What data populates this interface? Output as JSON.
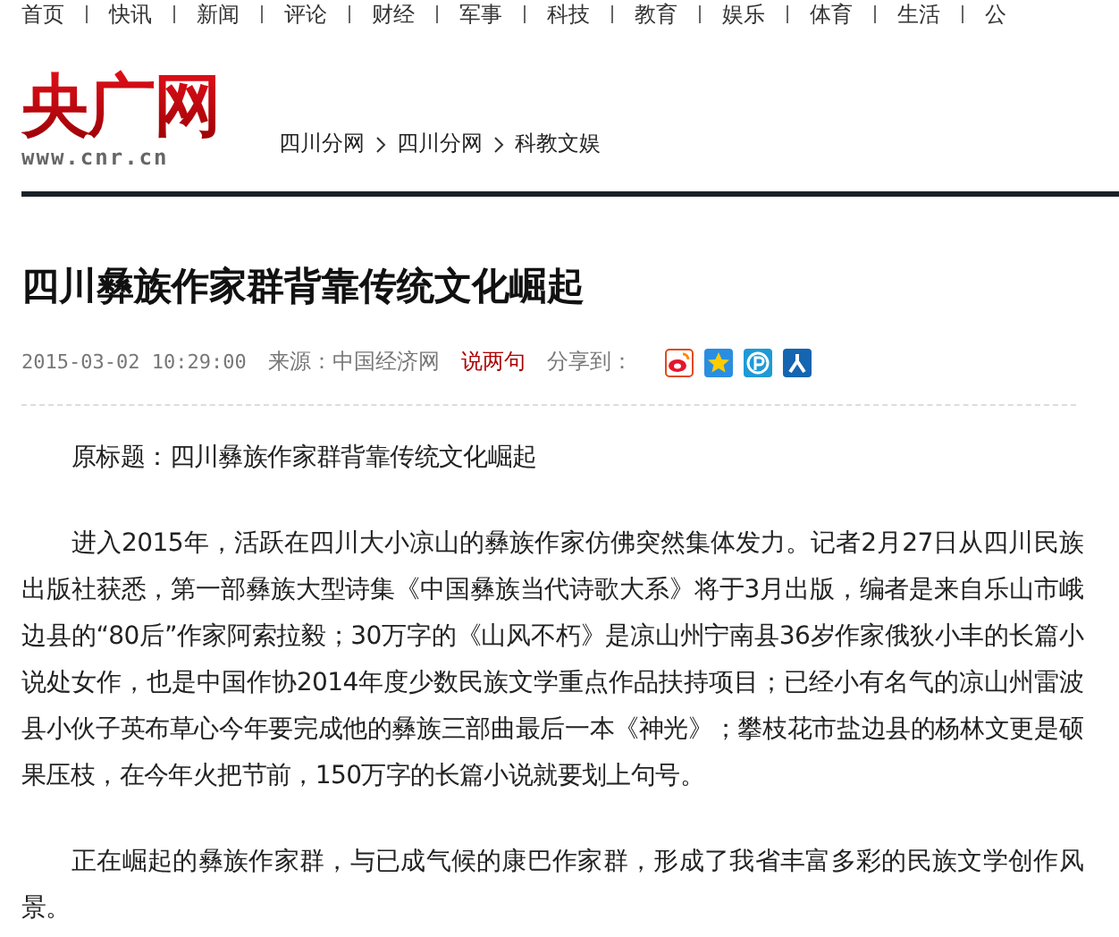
{
  "top_nav": [
    "首页",
    "快讯",
    "新闻",
    "评论",
    "财经",
    "军事",
    "科技",
    "教育",
    "娱乐",
    "体育",
    "生活",
    "公"
  ],
  "logo": {
    "name": "央广网",
    "url": "www.cnr.cn"
  },
  "breadcrumb": [
    "四川分网",
    "四川分网",
    "科教文娱"
  ],
  "article": {
    "title": "四川彝族作家群背靠传统文化崛起",
    "meta": {
      "date": "2015-03-02 10:29:00",
      "source": "来源：中国经济网",
      "comment_link": "说两句",
      "share_label": "分享到："
    },
    "share_icons": [
      {
        "kind": "weibo"
      },
      {
        "kind": "qzone"
      },
      {
        "kind": "pengyou"
      },
      {
        "kind": "renren"
      }
    ],
    "paragraphs": [
      "原标题：四川彝族作家群背靠传统文化崛起",
      "进入2015年，活跃在四川大小凉山的彝族作家仿佛突然集体发力。记者2月27日从四川民族出版社获悉，第一部彝族大型诗集《中国彝族当代诗歌大系》将于3月出版，编者是来自乐山市峨边县的“80后”作家阿索拉毅；30万字的《山风不朽》是凉山州宁南县36岁作家俄狄小丰的长篇小说处女作，也是中国作协2014年度少数民族文学重点作品扶持项目；已经小有名气的凉山州雷波县小伙子英布草心今年要完成他的彝族三部曲最后一本《神光》；攀枝花市盐边县的杨林文更是硕果压枝，在今年火把节前，150万字的长篇小说就要划上句号。",
      "正在崛起的彝族作家群，与已成气候的康巴作家群，形成了我省丰富多彩的民族文学创作风景。"
    ]
  }
}
